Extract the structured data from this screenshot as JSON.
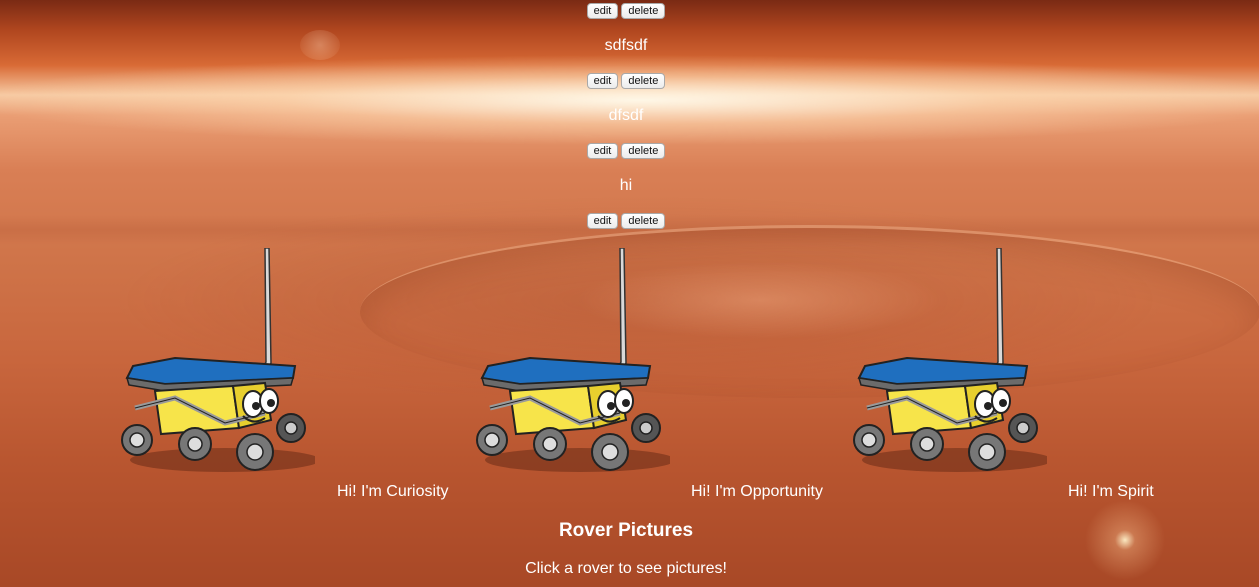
{
  "posts": [
    {
      "title": "",
      "edit_label": "edit",
      "delete_label": "delete"
    },
    {
      "title": "sdfsdf",
      "edit_label": "edit",
      "delete_label": "delete"
    },
    {
      "title": "dfsdf",
      "edit_label": "edit",
      "delete_label": "delete"
    },
    {
      "title": "hi",
      "edit_label": "edit",
      "delete_label": "delete"
    }
  ],
  "rovers": [
    {
      "name": "Curiosity",
      "caption": "Hi! I'm Curiosity",
      "icon": "rover-cartoon-icon"
    },
    {
      "name": "Opportunity",
      "caption": "Hi! I'm Opportunity",
      "icon": "rover-cartoon-icon"
    },
    {
      "name": "Spirit",
      "caption": "Hi! I'm Spirit",
      "icon": "rover-cartoon-icon"
    }
  ],
  "pictures_section": {
    "title": "Rover Pictures",
    "hint": "Click a rover to see pictures!"
  },
  "colors": {
    "rover_panel": "#1f6fbf",
    "rover_body": "#f7e44a",
    "text": "#ffffff"
  }
}
